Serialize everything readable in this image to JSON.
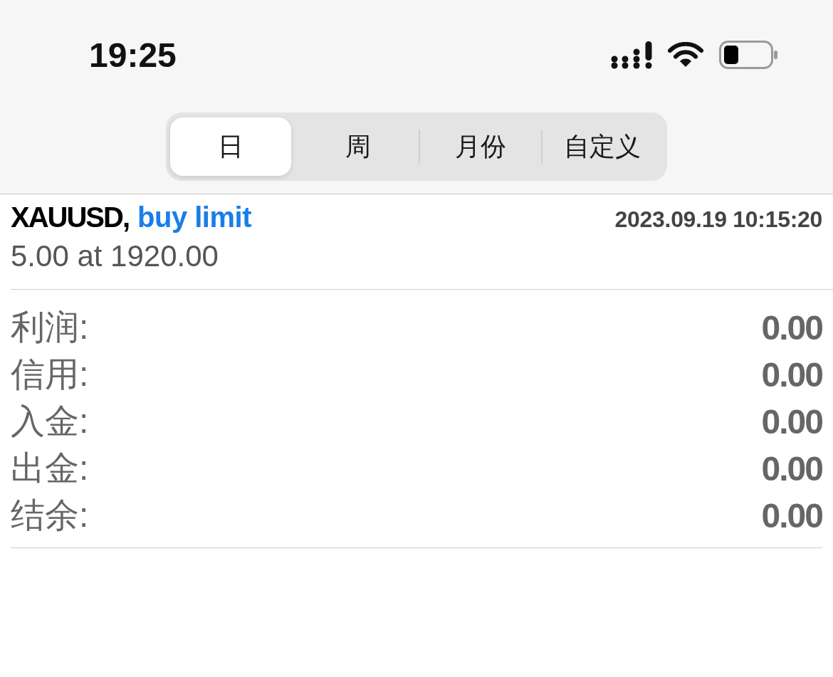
{
  "status_bar": {
    "time": "19:25"
  },
  "period_tabs": [
    {
      "label": "日",
      "selected": true
    },
    {
      "label": "周",
      "selected": false
    },
    {
      "label": "月份",
      "selected": false
    },
    {
      "label": "自定义",
      "selected": false
    }
  ],
  "orders": [
    {
      "symbol": "XAUUSD,",
      "type": "buy limit",
      "time": "2023.09.19 10:15:20",
      "volume_price": "5.00 at 1920.00"
    }
  ],
  "summary": [
    {
      "label": "利润:",
      "value": "0.00"
    },
    {
      "label": "信用:",
      "value": "0.00"
    },
    {
      "label": "入金:",
      "value": "0.00"
    },
    {
      "label": "出金:",
      "value": "0.00"
    },
    {
      "label": "结余:",
      "value": "0.00"
    }
  ]
}
